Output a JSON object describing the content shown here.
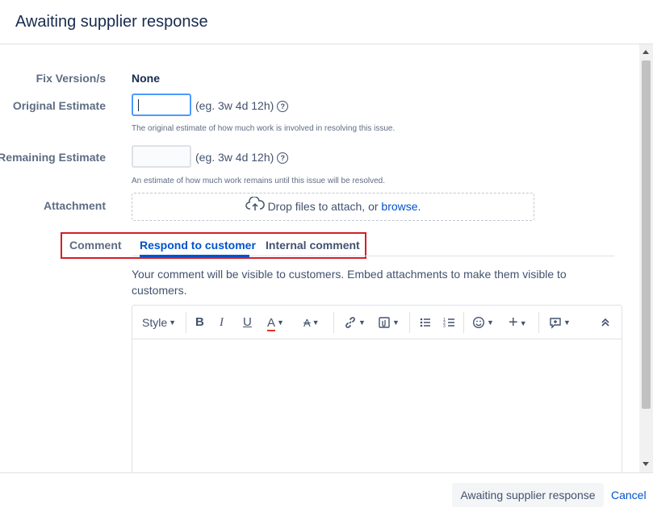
{
  "dialog": {
    "title": "Awaiting supplier response"
  },
  "form": {
    "fix_version": {
      "label": "Fix Version/s",
      "value": "None"
    },
    "original_estimate": {
      "label": "Original Estimate",
      "hint": "(eg. 3w 4d 12h)",
      "description": "The original estimate of how much work is involved in resolving this issue."
    },
    "remaining_estimate": {
      "label": "Remaining Estimate",
      "hint": "(eg. 3w 4d 12h)",
      "description": "An estimate of how much work remains until this issue will be resolved."
    },
    "attachment": {
      "label": "Attachment",
      "drop_text": "Drop files to attach, or",
      "browse_link": "browse."
    },
    "comment": {
      "label": "Comment",
      "tabs": [
        "Respond to customer",
        "Internal comment"
      ],
      "active_tab": "Respond to customer",
      "note": "Your comment will be visible to customers. Embed attachments to make them visible to customers."
    }
  },
  "toolbar": {
    "style": "Style",
    "bold": "B",
    "italic": "I",
    "underline": "U",
    "text_color": "A",
    "format": "A",
    "icons": [
      "bold-icon",
      "italic-icon",
      "underline-icon",
      "text-color-icon",
      "text-format-icon",
      "link-icon",
      "attachment-icon",
      "bullet-list-icon",
      "numbered-list-icon",
      "emoji-icon",
      "insert-icon",
      "comment-macro-icon",
      "collapse-icon"
    ],
    "text_color_accent": "#de350b"
  },
  "footer": {
    "submit": "Awaiting supplier response",
    "cancel": "Cancel"
  },
  "colors": {
    "accent": "#0052cc",
    "highlight_box": "#d21f2a"
  }
}
